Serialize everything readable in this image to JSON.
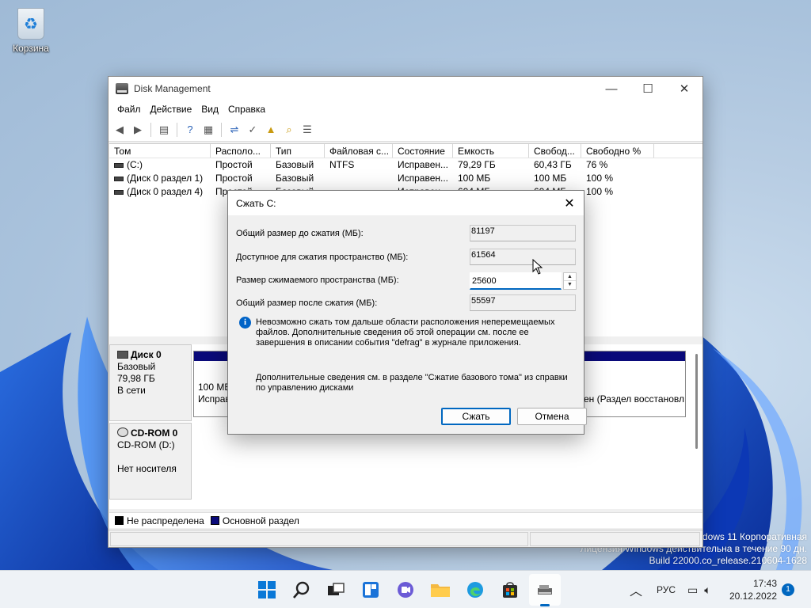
{
  "desktop": {
    "recycle_bin_label": "Корзина",
    "watermark": {
      "line1": "dows 11 Корпоративная",
      "line2": "Лицензия Windows действительна в течение 90 дн.",
      "line3": "Build 22000.co_release.210604-1628"
    }
  },
  "window": {
    "title": "Disk Management",
    "controls": {
      "minimize": "—",
      "maximize": "☐",
      "close": "✕"
    },
    "menu": [
      "Файл",
      "Действие",
      "Вид",
      "Справка"
    ],
    "toolbar_icons": [
      "back-arrow-icon",
      "forward-arrow-icon",
      "properties-icon",
      "help-icon",
      "list-icon",
      "connect-icon",
      "check-icon",
      "folder-up-icon",
      "search-icon",
      "settings-icon"
    ],
    "volume_list": {
      "columns": [
        "Том",
        "Располо...",
        "Тип",
        "Файловая с...",
        "Состояние",
        "Емкость",
        "Свобод...",
        "Свободно %"
      ],
      "rows": [
        [
          "(C:)",
          "Простой",
          "Базовый",
          "NTFS",
          "Исправен...",
          "79,29 ГБ",
          "60,43 ГБ",
          "76 %"
        ],
        [
          "(Диск 0 раздел 1)",
          "Простой",
          "Базовый",
          "",
          "Исправен...",
          "100 МБ",
          "100 МБ",
          "100 %"
        ],
        [
          "(Диск 0 раздел 4)",
          "Простой",
          "Базовый",
          "",
          "Исправен...",
          "604 МБ",
          "604 МБ",
          "100 %"
        ]
      ]
    },
    "disks": [
      {
        "name": "Диск 0",
        "type": "Базовый",
        "size": "79,98 ГБ",
        "status": "В сети"
      },
      {
        "name": "CD-ROM 0",
        "type": "CD-ROM (D:)",
        "size": "",
        "status": "Нет носителя"
      }
    ],
    "partitions": {
      "left": {
        "line1": "100 МБ",
        "line2": "Исправ"
      },
      "right": {
        "line2": "ен (Раздел восстановл"
      }
    },
    "legend": [
      {
        "label": "Не распределена",
        "color": "#000000"
      },
      {
        "label": "Основной раздел",
        "color": "#0a0a7a"
      }
    ]
  },
  "dialog": {
    "title": "Сжать C:",
    "close": "✕",
    "fields": {
      "total_before_label": "Общий размер до сжатия (МБ):",
      "total_before_value": "81197",
      "available_label": "Доступное для сжатия пространство (МБ):",
      "available_value": "61564",
      "shrink_label": "Размер сжимаемого пространства (МБ):",
      "shrink_value": "25600",
      "total_after_label": "Общий размер после сжатия (МБ):",
      "total_after_value": "55597"
    },
    "info_text": "Невозможно сжать том дальше области расположения неперемещаемых файлов. Дополнительные сведения об этой операции см. после ее завершения в описании события \"defrag\" в журнале приложения.",
    "more_info_text": "Дополнительные сведения см. в разделе \"Сжатие базового тома\" из справки по управлению дисками",
    "buttons": {
      "ok": "Сжать",
      "cancel": "Отмена"
    }
  },
  "taskbar": {
    "icons": [
      "start-icon",
      "search-icon",
      "task-view-icon",
      "widgets-icon",
      "chat-icon",
      "file-explorer-icon",
      "edge-icon",
      "store-icon",
      "disk-management-icon"
    ],
    "language": "РУС",
    "time": "17:43",
    "date": "20.12.2022",
    "notification_count": "1"
  },
  "colors": {
    "accent": "#0067c0",
    "primary_partition": "#0a0a7a"
  }
}
